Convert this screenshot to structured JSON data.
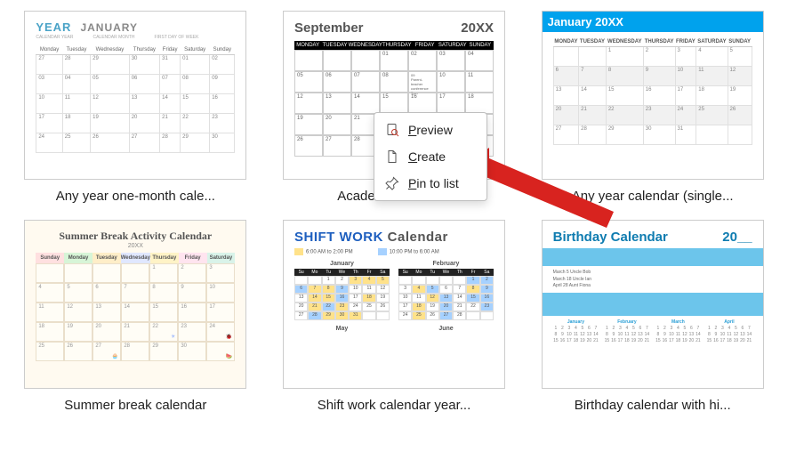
{
  "templates": [
    {
      "caption": "Any year one-month cale...",
      "yearLabel": "YEAR",
      "monthLabel": "JANUARY",
      "subLabels": [
        "CALENDAR YEAR",
        "CALENDAR MONTH",
        "FIRST DAY OF WEEK"
      ],
      "weekday_long": [
        "Monday",
        "Tuesday",
        "Wednesday",
        "Thursday",
        "Friday",
        "Saturday",
        "Sunday"
      ]
    },
    {
      "caption": "Academic calendar",
      "month": "September",
      "year": "20XX",
      "weekday_short": [
        "MONDAY",
        "TUESDAY",
        "WEDNESDAY",
        "THURSDAY",
        "FRIDAY",
        "SATURDAY",
        "SUNDAY"
      ],
      "note": "Parent-teacher conference 7pm"
    },
    {
      "caption": "Any year calendar (single...",
      "title": "January 20XX",
      "weekday_short": [
        "MONDAY",
        "TUESDAY",
        "WEDNESDAY",
        "THURSDAY",
        "FRIDAY",
        "SATURDAY",
        "SUNDAY"
      ]
    },
    {
      "caption": "Summer break calendar",
      "title": "Summer Break Activity Calendar",
      "sub": "20XX",
      "weekday_short": [
        "Sunday",
        "Monday",
        "Tuesday",
        "Wednesday",
        "Thursday",
        "Friday",
        "Saturday"
      ]
    },
    {
      "caption": "Shift work calendar year...",
      "titleA": "SHIFT WORK",
      "titleB": "Calendar",
      "legend": [
        {
          "label": "6:00 AM to 2:00 PM"
        },
        {
          "label": "10:00 PM to 6:00 AM"
        }
      ],
      "months": [
        "January",
        "February",
        "May",
        "June"
      ],
      "weekday_short": [
        "Su",
        "Mo",
        "Tu",
        "We",
        "Th",
        "Fr",
        "Sa"
      ]
    },
    {
      "caption": "Birthday calendar with hi...",
      "title": "Birthday Calendar",
      "year": "20__",
      "names": [
        "March 5   Uncle Bob",
        "March 18  Uncle Ian",
        "April 28   Aunt Fiona"
      ],
      "months": [
        "January",
        "February",
        "March",
        "April"
      ]
    }
  ],
  "contextMenu": {
    "items": [
      {
        "label": "Preview",
        "icon": "preview-icon"
      },
      {
        "label": "Create",
        "icon": "create-icon"
      },
      {
        "label": "Pin to list",
        "icon": "pin-icon"
      }
    ]
  }
}
